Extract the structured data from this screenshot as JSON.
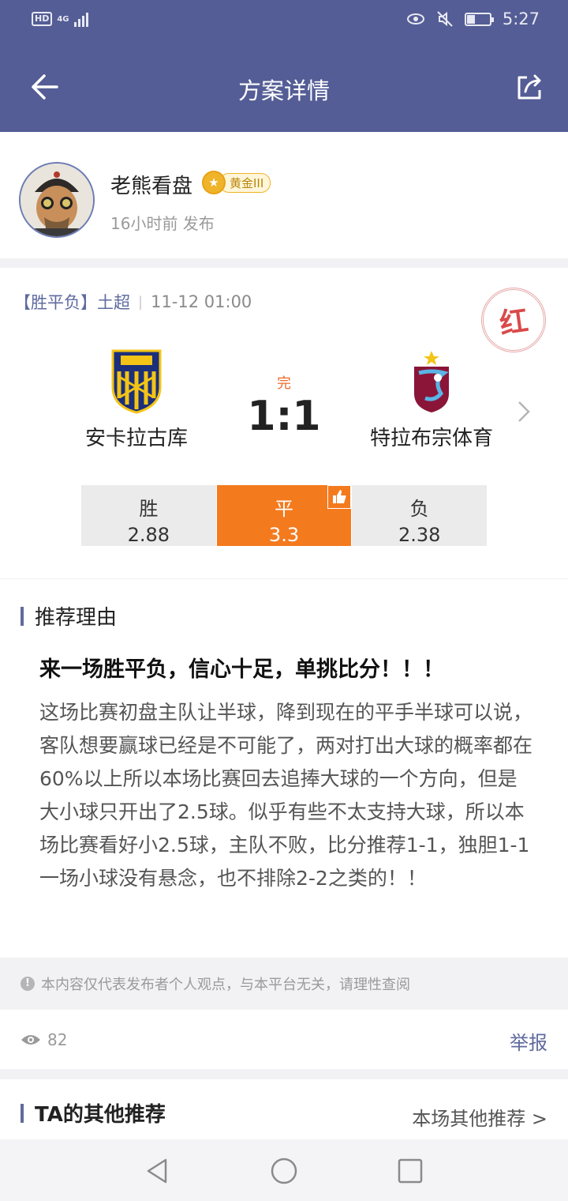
{
  "status_bar": {
    "hd": "HD",
    "network": "4G",
    "time": "5:27"
  },
  "nav": {
    "title": "方案详情"
  },
  "author": {
    "name": "老熊看盘",
    "level_badge": "黄金III",
    "published": "16小时前 发布"
  },
  "match": {
    "play_type": "【胜平负】",
    "league": "土超",
    "datetime": "11-12  01:00",
    "result_stamp": "红",
    "status": "完",
    "score": "1:1",
    "home_team": "安卡拉古库",
    "away_team": "特拉布宗体育",
    "odds": [
      {
        "label": "胜",
        "value": "2.88",
        "selected": false
      },
      {
        "label": "平",
        "value": "3.3",
        "selected": true
      },
      {
        "label": "负",
        "value": "2.38",
        "selected": false
      }
    ]
  },
  "reason": {
    "section_title": "推荐理由",
    "headline": "来一场胜平负，信心十足，单挑比分！！！",
    "body": "这场比赛初盘主队让半球，降到现在的平手半球可以说，客队想要赢球已经是不可能了，两对打出大球的概率都在60%以上所以本场比赛回去追捧大球的一个方向，但是大小球只开出了2.5球。似乎有些不太支持大球，所以本场比赛看好小2.5球，主队不败，比分推荐1-1，独胆1-1一场小球没有悬念，也不排除2-2之类的！！"
  },
  "disclaimer": "本内容仅代表发布者个人观点，与本平台无关，请理性查阅",
  "stats": {
    "views": "82",
    "report_label": "举报"
  },
  "others": {
    "section_title": "TA的其他推荐",
    "more_label": "本场其他推荐 >"
  },
  "colors": {
    "header": "#545d95",
    "accent_orange": "#f47a1e",
    "link_blue": "#5f6a9f",
    "stamp_red": "#d94a4a"
  }
}
